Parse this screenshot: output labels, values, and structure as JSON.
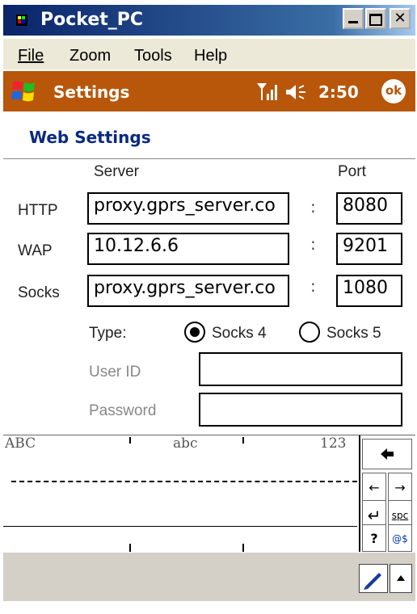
{
  "window": {
    "title": "Pocket_PC"
  },
  "menu": [
    {
      "label": "File"
    },
    {
      "label": "Zoom"
    },
    {
      "label": "Tools"
    },
    {
      "label": "Help"
    }
  ],
  "nav": {
    "title": "Settings",
    "time": "2:50",
    "ok_label": "ok"
  },
  "page": {
    "title": "Web Settings"
  },
  "form": {
    "server_header": "Server",
    "port_header": "Port",
    "rows": [
      {
        "label": "HTTP",
        "server": "proxy.gprs_server.co",
        "port": "8080"
      },
      {
        "label": "WAP",
        "server": "10.12.6.6",
        "port": "9201"
      },
      {
        "label": "Socks",
        "server": "proxy.gprs_server.co",
        "port": "1080"
      }
    ],
    "colon": ":",
    "type_label": "Type:",
    "socks4_label": "Socks 4",
    "socks5_label": "Socks 5",
    "type_selected": "Socks 4",
    "userid_label": "User ID",
    "password_label": "Password",
    "userid_value": "",
    "password_value": ""
  },
  "keyboard": {
    "modes": [
      "ABC",
      "abc",
      "123"
    ],
    "keys": {
      "backspace": "🡄",
      "left": "←",
      "right": "→",
      "enter": "↵",
      "space": "spc",
      "question": "?",
      "symbols": "@$"
    }
  },
  "colors": {
    "nav_bar": "#b8560a",
    "title_bar": "#0a246a",
    "page_title": "#0a2a80"
  }
}
